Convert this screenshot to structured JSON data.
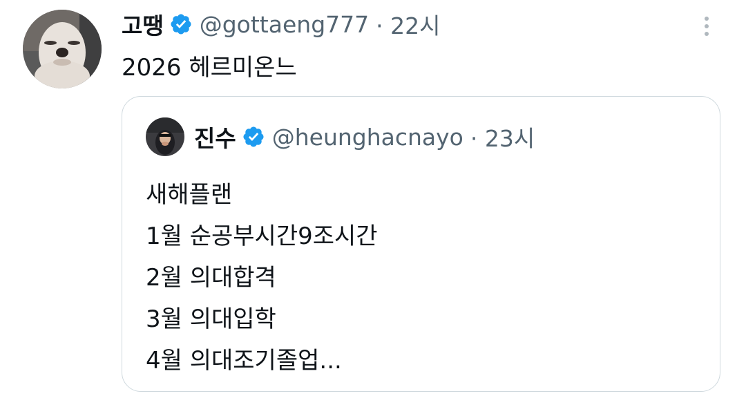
{
  "tweet": {
    "author": {
      "name": "고땡",
      "handle": "@gottaeng777",
      "verified": true
    },
    "time": "· 22시",
    "text": "2026 헤르미온느",
    "more_icon": "more-vertical-icon",
    "verified_color": "#1d9bf0",
    "quoted": {
      "author": {
        "name": "진수",
        "handle": "@heunghacnayo",
        "verified": true
      },
      "time": "· 23시",
      "lines": [
        "새해플랜",
        "1월 순공부시간9조시간",
        "2월 의대합격",
        "3월 의대입학",
        "4월 의대조기졸업..."
      ]
    }
  }
}
